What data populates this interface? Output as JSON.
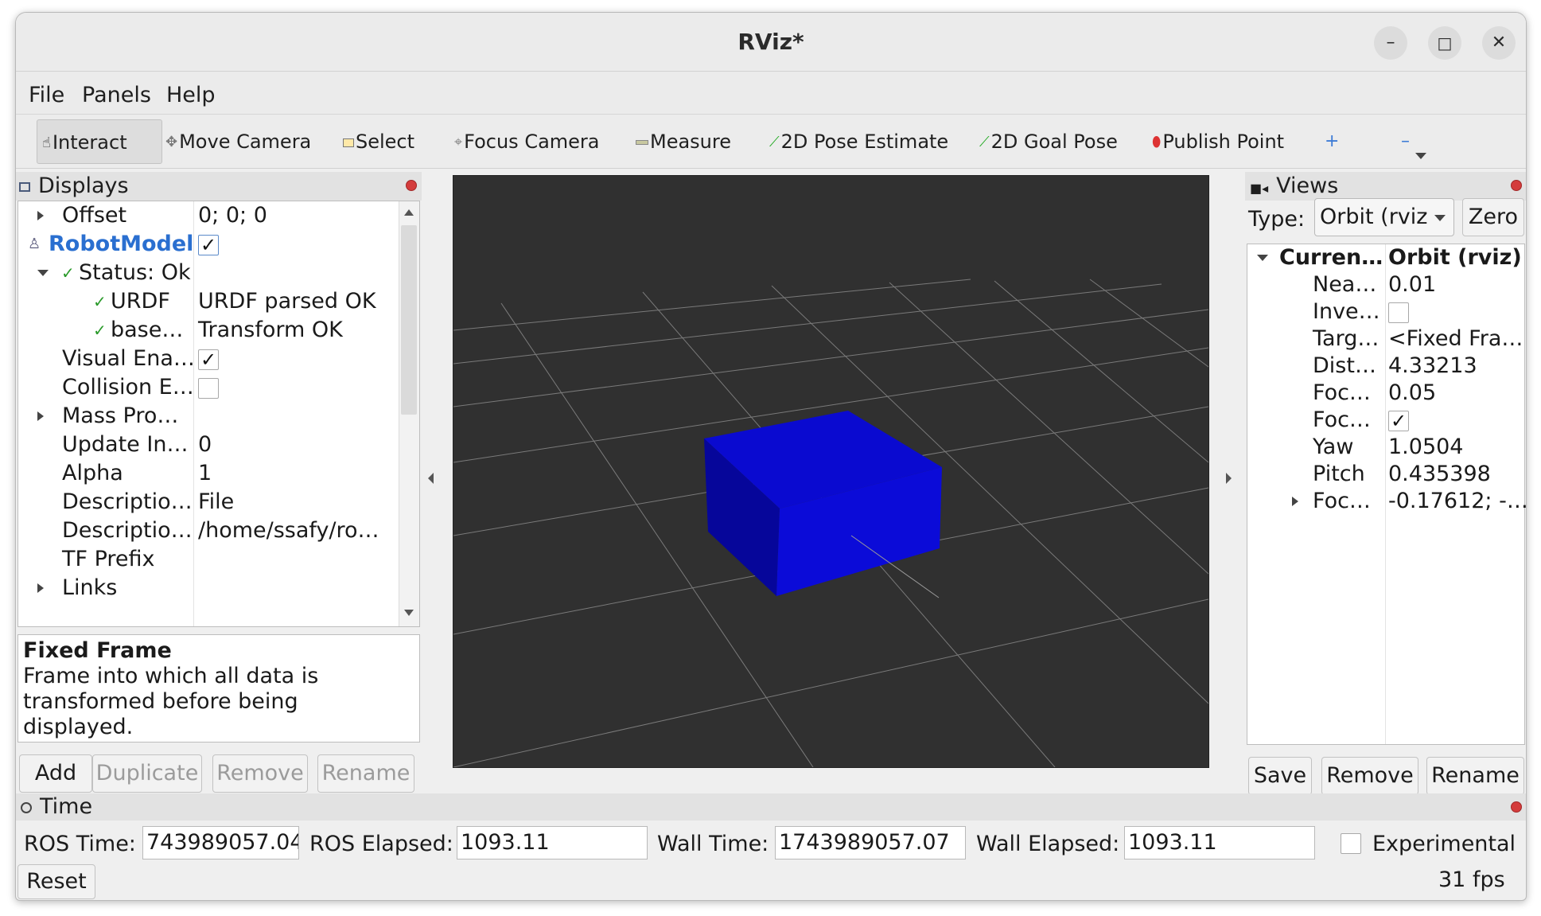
{
  "window": {
    "title": "RViz*",
    "min": "–",
    "max": "□",
    "close": "✕"
  },
  "menu": [
    "File",
    "Panels",
    "Help"
  ],
  "toolbar": {
    "interact": "Interact",
    "move_camera": "Move Camera",
    "select": "Select",
    "focus_camera": "Focus Camera",
    "measure": "Measure",
    "pose_estimate": "2D Pose Estimate",
    "goal_pose": "2D Goal Pose",
    "publish_point": "Publish Point",
    "add_tool": "+",
    "remove_tool": "–"
  },
  "displays": {
    "title": "Displays",
    "rows": [
      {
        "name": "Offset",
        "value": "0; 0; 0"
      },
      {
        "name": "RobotModel",
        "value": "✓"
      },
      {
        "name": "Status: Ok",
        "value": ""
      },
      {
        "name": "URDF",
        "value": "URDF parsed OK"
      },
      {
        "name": "base…",
        "value": "Transform OK"
      },
      {
        "name": "Visual Ena…",
        "value": "✓"
      },
      {
        "name": "Collision E…",
        "value": ""
      },
      {
        "name": "Mass Pro…",
        "value": ""
      },
      {
        "name": "Update In…",
        "value": "0"
      },
      {
        "name": "Alpha",
        "value": "1"
      },
      {
        "name": "Descriptio…",
        "value": "File"
      },
      {
        "name": "Descriptio…",
        "value": "/home/ssafy/ro…"
      },
      {
        "name": "TF Prefix",
        "value": ""
      },
      {
        "name": "Links",
        "value": ""
      }
    ],
    "help_title": "Fixed Frame",
    "help_text_1": "Frame into which all data is",
    "help_text_2": "transformed before being displayed.",
    "buttons": {
      "add": "Add",
      "duplicate": "Duplicate",
      "remove": "Remove",
      "rename": "Rename"
    }
  },
  "views": {
    "title": "Views",
    "type_label": "Type:",
    "type_value": "Orbit (rviz",
    "zero": "Zero",
    "rows": [
      {
        "name": "Curren…",
        "value": "Orbit (rviz)"
      },
      {
        "name": "Nea…",
        "value": "0.01"
      },
      {
        "name": "Inve…",
        "value": ""
      },
      {
        "name": "Targ…",
        "value": "<Fixed Fra…"
      },
      {
        "name": "Dist…",
        "value": "4.33213"
      },
      {
        "name": "Foc…",
        "value": "0.05"
      },
      {
        "name": "Foc…",
        "value": "✓"
      },
      {
        "name": "Yaw",
        "value": "1.0504"
      },
      {
        "name": "Pitch",
        "value": "0.435398"
      },
      {
        "name": "Foc…",
        "value": "-0.17612; -…"
      }
    ],
    "buttons": {
      "save": "Save",
      "remove": "Remove",
      "rename": "Rename"
    }
  },
  "time": {
    "title": "Time",
    "ros_time_label": "ROS Time:",
    "ros_time": "743989057.04",
    "ros_elapsed_label": "ROS Elapsed:",
    "ros_elapsed": "1093.11",
    "wall_time_label": "Wall Time:",
    "wall_time": "1743989057.07",
    "wall_elapsed_label": "Wall Elapsed:",
    "wall_elapsed": "1093.11",
    "experimental": "Experimental",
    "reset": "Reset",
    "fps": "31 fps"
  },
  "colors": {
    "robot_box": "#0a0ad0",
    "link_blue": "#2a6fd0",
    "viewport_bg": "#303030"
  }
}
